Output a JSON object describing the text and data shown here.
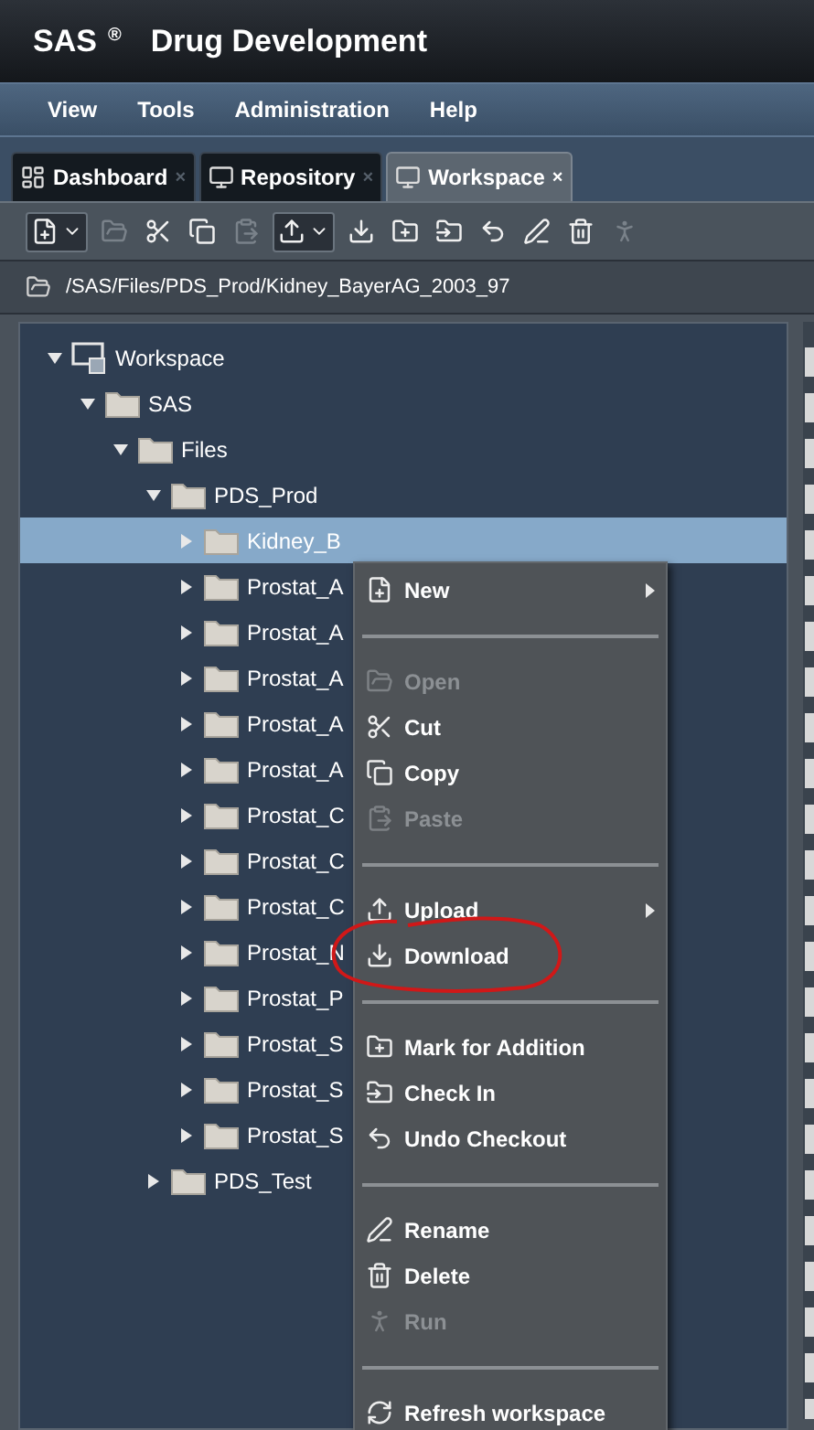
{
  "app": {
    "brand": "SAS",
    "mark": "®",
    "title": "Drug Development"
  },
  "menu_bar": [
    "View",
    "Tools",
    "Administration",
    "Help"
  ],
  "tabs": [
    {
      "label": "Dashboard",
      "close": "×",
      "selected": false
    },
    {
      "label": "Repository",
      "close": "×",
      "selected": false
    },
    {
      "label": "Workspace",
      "close": "×",
      "selected": true
    }
  ],
  "toolbar": [
    {
      "disabled": false,
      "dropdown": true
    },
    {
      "disabled": true,
      "dropdown": false
    },
    {
      "disabled": false,
      "dropdown": false
    },
    {
      "disabled": false,
      "dropdown": false
    },
    {
      "disabled": true,
      "dropdown": false
    },
    {
      "disabled": false,
      "dropdown": true
    },
    {
      "disabled": false,
      "dropdown": false
    },
    {
      "disabled": false,
      "dropdown": false
    },
    {
      "disabled": false,
      "dropdown": false
    },
    {
      "disabled": false,
      "dropdown": false
    },
    {
      "disabled": false,
      "dropdown": false
    },
    {
      "disabled": false,
      "dropdown": false
    },
    {
      "disabled": true,
      "dropdown": false
    }
  ],
  "path": "/SAS/Files/PDS_Prod/Kidney_BayerAG_2003_97",
  "tree": [
    {
      "label": "Workspace",
      "kind": "workspace",
      "expanded": true,
      "selected": false,
      "children": [
        {
          "label": "SAS",
          "kind": "folder",
          "expanded": true,
          "selected": false,
          "children": [
            {
              "label": "Files",
              "kind": "folder",
              "expanded": true,
              "selected": false,
              "children": [
                {
                  "label": "PDS_Prod",
                  "kind": "folder",
                  "expanded": true,
                  "selected": false,
                  "children": [
                    {
                      "label": "Kidney_B",
                      "kind": "folder",
                      "expanded": false,
                      "selected": true
                    },
                    {
                      "label": "Prostat_A",
                      "kind": "folder",
                      "expanded": false,
                      "selected": false
                    },
                    {
                      "label": "Prostat_A",
                      "kind": "folder",
                      "expanded": false,
                      "selected": false
                    },
                    {
                      "label": "Prostat_A",
                      "kind": "folder",
                      "expanded": false,
                      "selected": false
                    },
                    {
                      "label": "Prostat_A",
                      "kind": "folder",
                      "expanded": false,
                      "selected": false
                    },
                    {
                      "label": "Prostat_A",
                      "kind": "folder",
                      "expanded": false,
                      "selected": false
                    },
                    {
                      "label": "Prostat_C",
                      "kind": "folder",
                      "expanded": false,
                      "selected": false
                    },
                    {
                      "label": "Prostat_C",
                      "kind": "folder",
                      "expanded": false,
                      "selected": false
                    },
                    {
                      "label": "Prostat_C",
                      "kind": "folder",
                      "expanded": false,
                      "selected": false
                    },
                    {
                      "label": "Prostat_N",
                      "kind": "folder",
                      "expanded": false,
                      "selected": false
                    },
                    {
                      "label": "Prostat_P",
                      "kind": "folder",
                      "expanded": false,
                      "selected": false
                    },
                    {
                      "label": "Prostat_S",
                      "kind": "folder",
                      "expanded": false,
                      "selected": false
                    },
                    {
                      "label": "Prostat_S",
                      "kind": "folder",
                      "expanded": false,
                      "selected": false
                    },
                    {
                      "label": "Prostat_S",
                      "kind": "folder",
                      "expanded": false,
                      "selected": false
                    }
                  ]
                },
                {
                  "label": "PDS_Test",
                  "kind": "folder",
                  "expanded": false,
                  "selected": false
                }
              ]
            }
          ]
        }
      ]
    }
  ],
  "context_menu": [
    {
      "kind": "item",
      "label": "New",
      "disabled": false,
      "submenu": true
    },
    {
      "kind": "separator"
    },
    {
      "kind": "item",
      "label": "Open",
      "disabled": true,
      "submenu": false
    },
    {
      "kind": "item",
      "label": "Cut",
      "disabled": false,
      "submenu": false
    },
    {
      "kind": "item",
      "label": "Copy",
      "disabled": false,
      "submenu": false
    },
    {
      "kind": "item",
      "label": "Paste",
      "disabled": true,
      "submenu": false
    },
    {
      "kind": "separator"
    },
    {
      "kind": "item",
      "label": "Upload",
      "disabled": false,
      "submenu": true
    },
    {
      "kind": "item",
      "label": "Download",
      "disabled": false,
      "submenu": false,
      "circled": true
    },
    {
      "kind": "separator"
    },
    {
      "kind": "item",
      "label": "Mark for Addition",
      "disabled": false,
      "submenu": false
    },
    {
      "kind": "item",
      "label": "Check In",
      "disabled": false,
      "submenu": false
    },
    {
      "kind": "item",
      "label": "Undo Checkout",
      "disabled": false,
      "submenu": false
    },
    {
      "kind": "separator"
    },
    {
      "kind": "item",
      "label": "Rename",
      "disabled": false,
      "submenu": false
    },
    {
      "kind": "item",
      "label": "Delete",
      "disabled": false,
      "submenu": false
    },
    {
      "kind": "item",
      "label": "Run",
      "disabled": true,
      "submenu": false
    },
    {
      "kind": "separator"
    },
    {
      "kind": "item",
      "label": "Refresh workspace",
      "disabled": false,
      "submenu": false
    }
  ]
}
